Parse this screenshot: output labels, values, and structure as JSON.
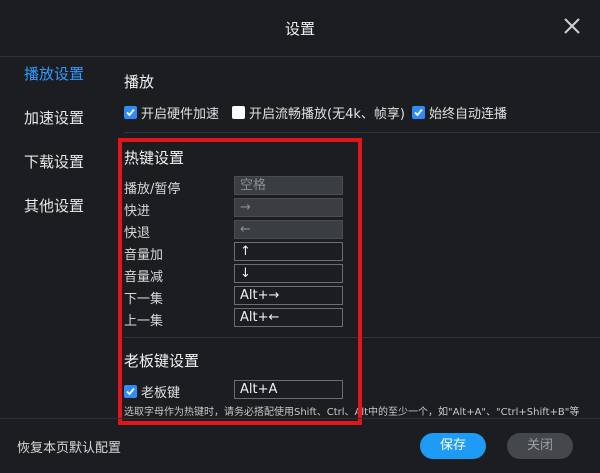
{
  "window": {
    "title": "设置"
  },
  "sidebar": {
    "items": [
      {
        "label": "播放设置",
        "active": true
      },
      {
        "label": "加速设置",
        "active": false
      },
      {
        "label": "下载设置",
        "active": false
      },
      {
        "label": "其他设置",
        "active": false
      }
    ]
  },
  "playback": {
    "title": "播放",
    "options": [
      {
        "label": "开启硬件加速",
        "checked": true
      },
      {
        "label": "开启流畅播放(无4k、帧享)",
        "checked": false
      },
      {
        "label": "始终自动连播",
        "checked": true
      }
    ]
  },
  "hotkeys": {
    "title": "热键设置",
    "items": [
      {
        "label": "播放/暂停",
        "value": "空格",
        "enabled": false
      },
      {
        "label": "快进",
        "value": "→",
        "enabled": false
      },
      {
        "label": "快退",
        "value": "←",
        "enabled": false
      },
      {
        "label": "音量加",
        "value": "↑",
        "enabled": true
      },
      {
        "label": "音量减",
        "value": "↓",
        "enabled": true
      },
      {
        "label": "下一集",
        "value": "Alt+→",
        "enabled": true
      },
      {
        "label": "上一集",
        "value": "Alt+←",
        "enabled": true
      }
    ]
  },
  "boss_key": {
    "title": "老板键设置",
    "label": "老板键",
    "checked": true,
    "value": "Alt+A",
    "note": "选取字母作为热键时，请务必搭配使用Shift、Ctrl、Alt中的至少一个，如\"Alt+A\"、\"Ctrl+Shift+B\"等"
  },
  "footer": {
    "restore_label": "恢复本页默认配置",
    "save_label": "保存",
    "close_label": "关闭"
  },
  "colors": {
    "accent": "#2f9bff",
    "highlight_box": "#e0161b",
    "save_button": "#1e9cf5"
  }
}
